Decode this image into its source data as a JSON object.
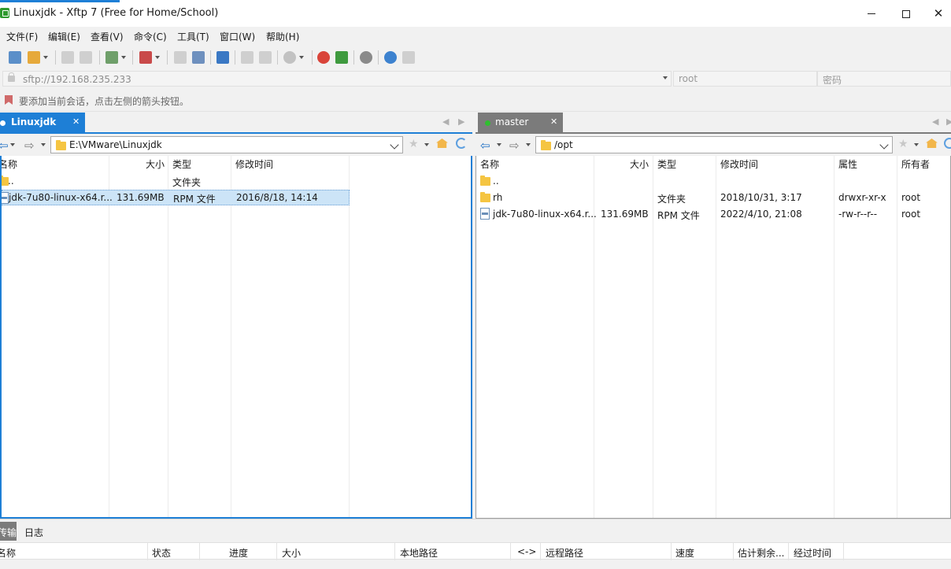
{
  "window": {
    "title": "Linuxjdk - Xftp 7 (Free for Home/School)"
  },
  "menu": [
    "文件(F)",
    "编辑(E)",
    "查看(V)",
    "命令(C)",
    "工具(T)",
    "窗口(W)",
    "帮助(H)"
  ],
  "address": {
    "host": "sftp://192.168.235.233",
    "user_placeholder": "root",
    "password_placeholder": "密码"
  },
  "hint": "要添加当前会话，点击左侧的箭头按钮。",
  "left_pane": {
    "tab_label": "Linuxjdk",
    "path": "E:\\VMware\\Linuxjdk",
    "columns": [
      "名称",
      "大小",
      "类型",
      "修改时间"
    ],
    "rows": [
      {
        "name": "..",
        "size": "",
        "type": "文件夹",
        "modified": ""
      },
      {
        "name": "jdk-7u80-linux-x64.r...",
        "size": "131.69MB",
        "type": "RPM 文件",
        "modified": "2016/8/18, 14:14"
      }
    ]
  },
  "right_pane": {
    "tab_label": "master",
    "path": "/opt",
    "columns": [
      "名称",
      "大小",
      "类型",
      "修改时间",
      "属性",
      "所有者"
    ],
    "rows": [
      {
        "name": "..",
        "size": "",
        "type": "",
        "modified": "",
        "attrs": "",
        "owner": ""
      },
      {
        "name": "rh",
        "size": "",
        "type": "文件夹",
        "modified": "2018/10/31, 3:17",
        "attrs": "drwxr-xr-x",
        "owner": "root"
      },
      {
        "name": "jdk-7u80-linux-x64.r...",
        "size": "131.69MB",
        "type": "RPM 文件",
        "modified": "2022/4/10, 21:08",
        "attrs": "-rw-r--r--",
        "owner": "root"
      }
    ]
  },
  "transfer": {
    "tabs": [
      "传输",
      "日志"
    ],
    "columns": [
      "名称",
      "状态",
      "进度",
      "大小",
      "本地路径",
      "<->",
      "远程路径",
      "速度",
      "估计剩余...",
      "经过时间"
    ]
  },
  "colors": {
    "accent": "#1e7fd6",
    "tab_inactive": "#7b7b7b",
    "selection": "#cce4f7",
    "folder": "#f5c542",
    "online_dot": "#2fbf2f"
  }
}
